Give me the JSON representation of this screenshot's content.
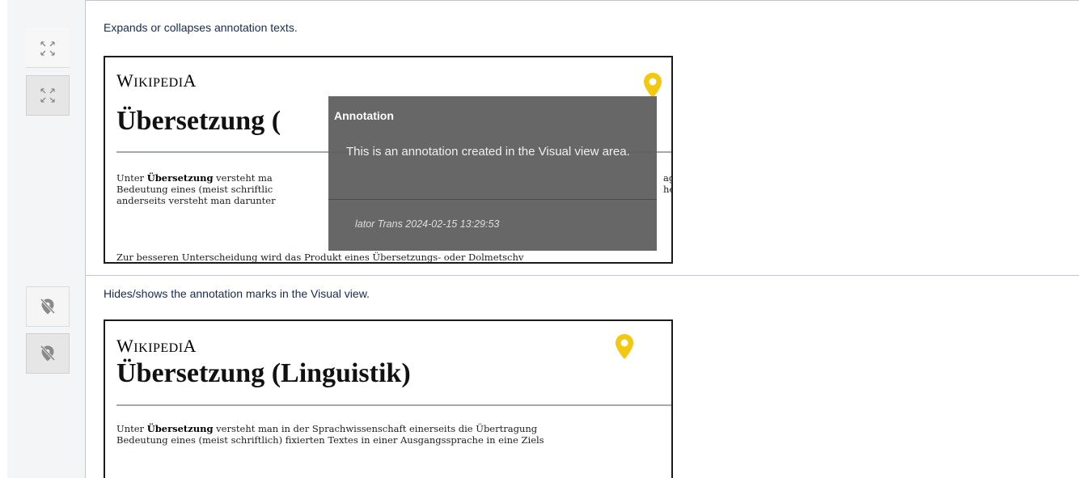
{
  "rows": [
    {
      "description": "Expands or collapses annotation texts.",
      "icon": "expand-collapse-icon",
      "screenshot": {
        "logo": "WIKIPEDIA",
        "title": "Übersetzung (",
        "body_lines": [
          [
            "Unter ",
            "Übersetzung",
            " versteht ma",
            "ag"
          ],
          [
            "Bedeutung eines (meist schriftlic",
            "",
            "",
            "he"
          ],
          [
            "anderseits versteht man darunter",
            "",
            "",
            ""
          ],
          [
            "Zur besseren Unterscheidung wird das Produkt eines Übersetzungs- oder Dolmetschv",
            "",
            "",
            ""
          ]
        ],
        "annotation": {
          "title": "Annotation",
          "text": "This is an annotation created in the Visual view area.",
          "meta": "lator Trans 2024-02-15 13:29:53"
        }
      }
    },
    {
      "description": "Hides/shows the annotation marks in the Visual view.",
      "icon": "hide-annotation-marks-icon",
      "screenshot": {
        "logo": "WIKIPEDIA",
        "title": "Übersetzung (Linguistik)",
        "body_lines": [
          [
            "Unter ",
            "Übersetzung",
            " versteht man in der Sprachwissenschaft einerseits die Übertragung",
            ""
          ],
          [
            "Bedeutung eines (meist schriftlich) fixierten Textes in einer Ausgangssprache in eine Ziels",
            "",
            "",
            ""
          ]
        ]
      }
    }
  ],
  "colors": {
    "pin": "#f2c811",
    "popup_bg": "#626262",
    "border": "#c1c7d0"
  }
}
